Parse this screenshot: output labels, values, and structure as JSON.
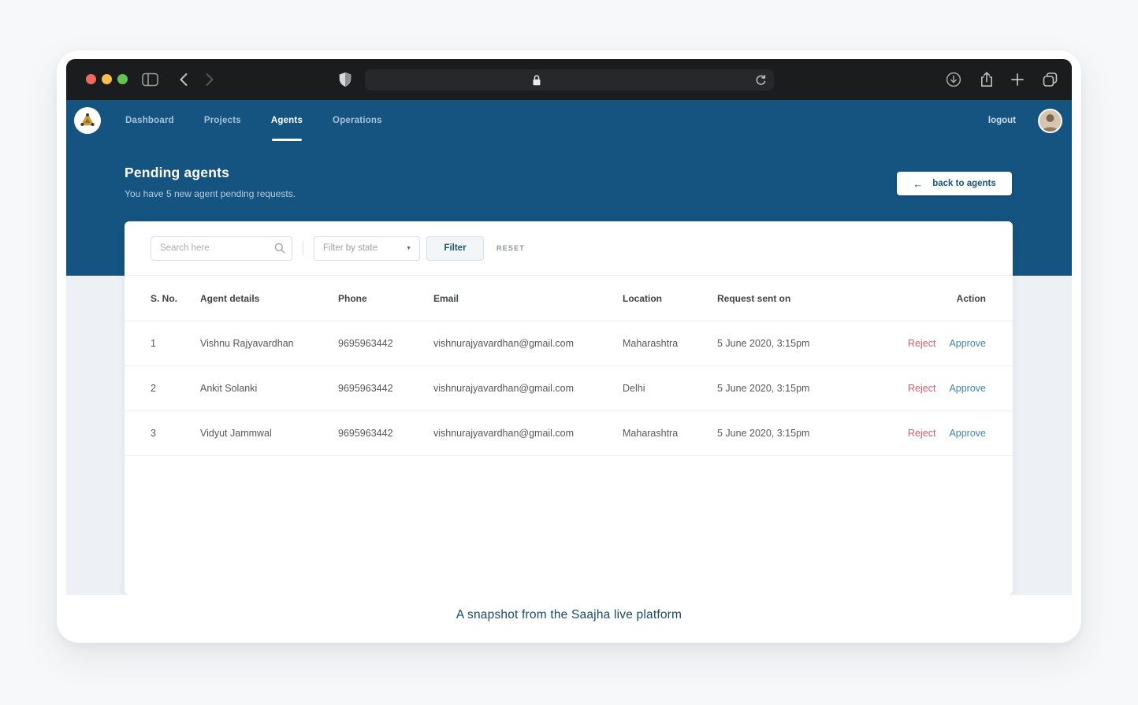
{
  "colors": {
    "brand_blue": "#155380",
    "chrome_dark": "#1b1c1e",
    "page_bg": "#edf1f5",
    "reject_red": "#e25767",
    "approve_blue": "#4384ab",
    "caption_navy": "#18486a",
    "traffic_red": "#ee6a5f",
    "traffic_yellow": "#f6bd50",
    "traffic_green": "#62c454"
  },
  "icons": {
    "chevron_down": "▼",
    "back_arrow": "←",
    "plus": "+",
    "search": "magnifier-svg",
    "lock": "padlock-svg",
    "reload": "reload-arc-svg",
    "shield": "shield-svg",
    "sidebar": "sidebar-panel-svg",
    "download": "circle-down-arrow-svg",
    "share": "box-up-arrow-svg",
    "tab_overview": "stacked-squares-svg"
  },
  "navbar": {
    "items": [
      {
        "label": "Dashboard",
        "active": false
      },
      {
        "label": "Projects",
        "active": false
      },
      {
        "label": "Agents",
        "active": true
      },
      {
        "label": "Operations",
        "active": false
      }
    ],
    "logout_label": "logout"
  },
  "hero": {
    "title": "Pending agents",
    "subtitle": "You have 5 new agent pending requests.",
    "back_button_arrow": "←",
    "back_button_label": "back to agents"
  },
  "filters": {
    "search_placeholder": "Search here",
    "state_select_value": "Filter by state",
    "filter_button_label": "Filter",
    "reset_label": "RESET"
  },
  "table": {
    "columns": [
      "S. No.",
      "Agent details",
      "Phone",
      "Email",
      "Location",
      "Request sent on",
      "Action"
    ],
    "rows": [
      {
        "sno": "1",
        "name": "Vishnu Rajyavardhan",
        "phone": "9695963442",
        "email": "vishnurajyavardhan@gmail.com",
        "location": "Maharashtra",
        "sent_on": "5 June 2020, 3:15pm",
        "reject": "Reject",
        "approve": "Approve"
      },
      {
        "sno": "2",
        "name": "Ankit Solanki",
        "phone": "9695963442",
        "email": "vishnurajyavardhan@gmail.com",
        "location": "Delhi",
        "sent_on": "5 June 2020, 3:15pm",
        "reject": "Reject",
        "approve": "Approve"
      },
      {
        "sno": "3",
        "name": "Vidyut Jammwal",
        "phone": "9695963442",
        "email": "vishnurajyavardhan@gmail.com",
        "location": "Maharashtra",
        "sent_on": "5 June 2020, 3:15pm",
        "reject": "Reject",
        "approve": "Approve"
      }
    ]
  },
  "caption": "A snapshot from the Saajha live platform"
}
